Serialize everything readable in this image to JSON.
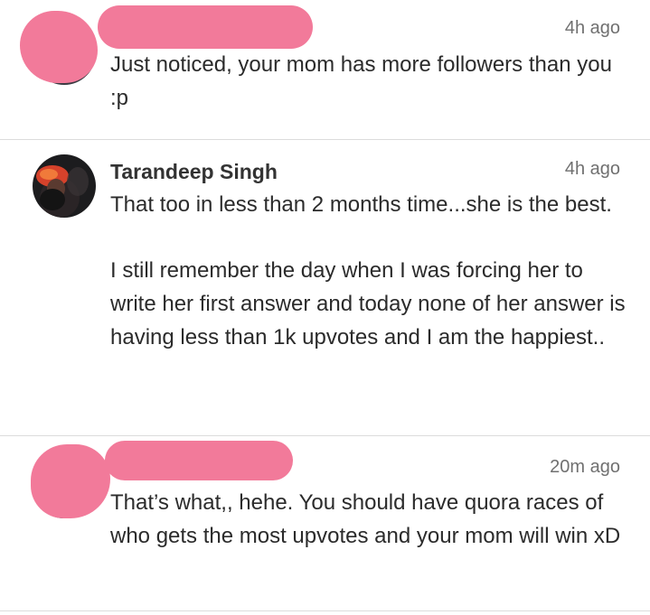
{
  "colors": {
    "redaction": "#f27a9a",
    "divider": "#dcdcdc",
    "text": "#2b2b2b",
    "muted": "#707070"
  },
  "comments": [
    {
      "author": "",
      "time": "4h ago",
      "paragraphs": [
        "Just noticed, your mom has more followers than you :p"
      ],
      "redacted": true
    },
    {
      "author": "Tarandeep Singh",
      "time": "4h ago",
      "paragraphs": [
        "That too in less than 2 months time...she is the best.",
        "I still remember the day when I was forcing her to write her first answer and today none of her answer is having less than 1k upvotes and I am the happiest.."
      ],
      "redacted": false
    },
    {
      "author": "",
      "time": "20m ago",
      "paragraphs": [
        "That’s what,, hehe. You should have quora races of who gets the most upvotes and your mom will win xD"
      ],
      "redacted": true
    }
  ]
}
